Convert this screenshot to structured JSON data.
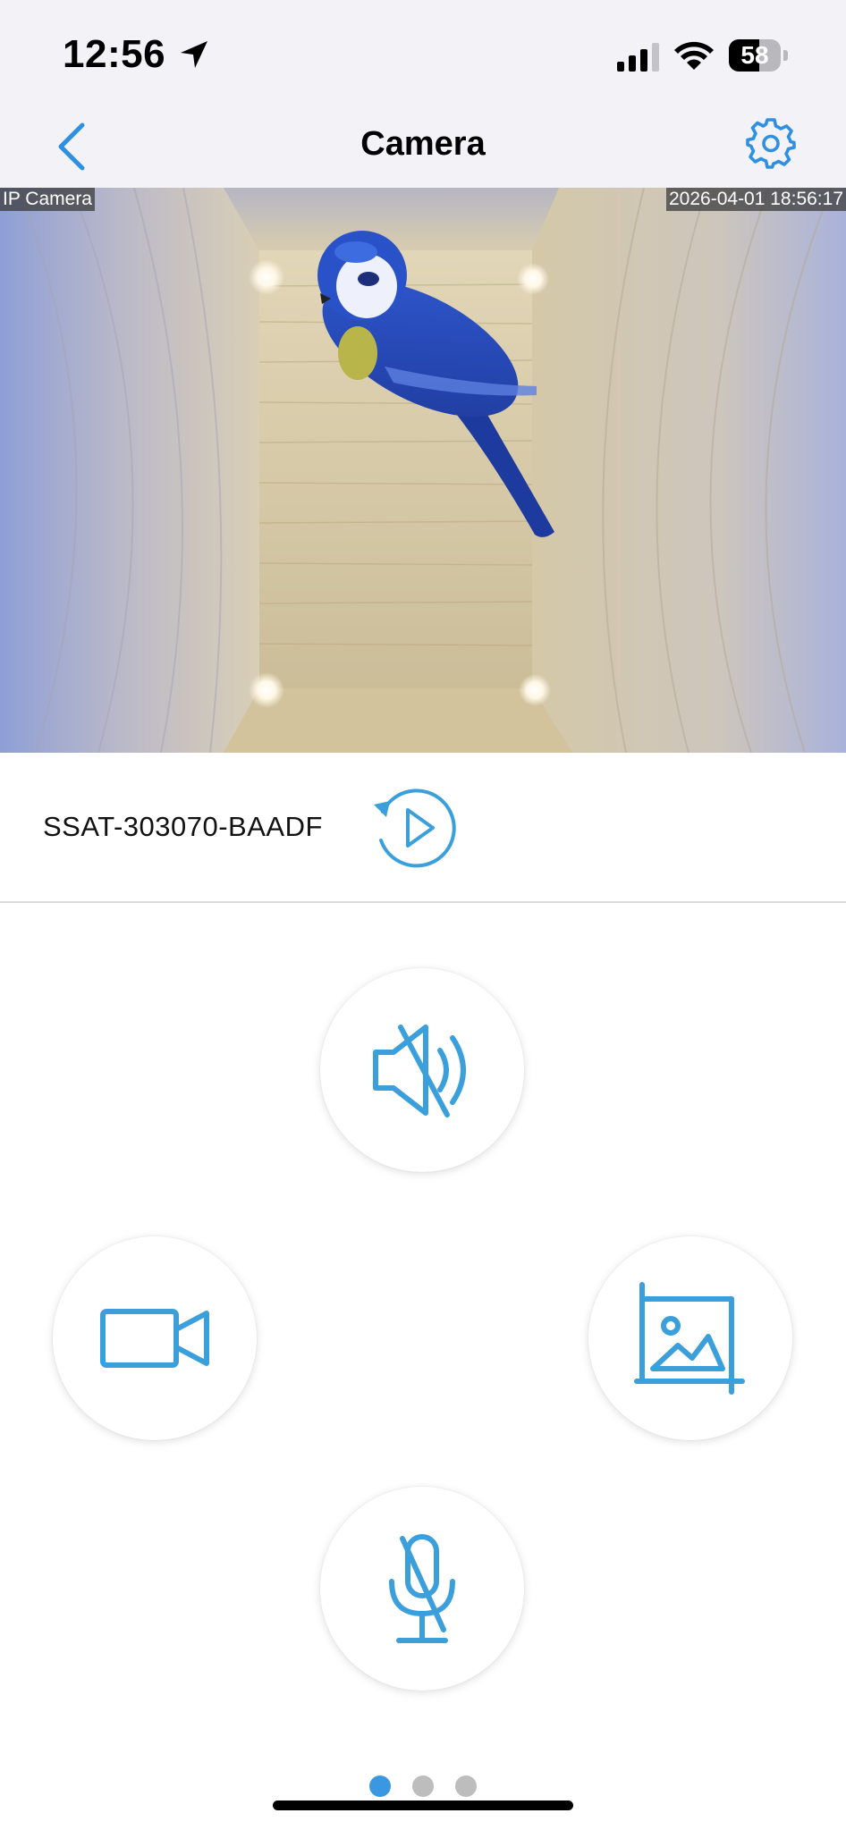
{
  "status_bar": {
    "time": "12:56",
    "battery_percent": "58",
    "battery_level": 0.58,
    "icons": [
      "location-arrow-icon",
      "cellular-signal-icon",
      "wifi-icon",
      "battery-icon"
    ]
  },
  "nav": {
    "title": "Camera",
    "back_icon": "chevron-left-icon",
    "settings_icon": "gear-icon"
  },
  "video": {
    "overlay_label": "IP Camera",
    "timestamp": "2026-04-01 18:56:17"
  },
  "device": {
    "name": "SSAT-303070-BAADF",
    "playback_icon": "replay-play-icon"
  },
  "controls": [
    {
      "id": "speaker",
      "icon": "speaker-muted-icon"
    },
    {
      "id": "record",
      "icon": "video-camera-icon"
    },
    {
      "id": "snapshot",
      "icon": "image-crop-icon"
    },
    {
      "id": "microphone",
      "icon": "microphone-muted-icon"
    }
  ],
  "pagination": {
    "pages": 3,
    "current": 1
  },
  "colors": {
    "accent": "#3a98e0",
    "icon_blue": "#3b9fdc",
    "nav_background": "#f2f2f7",
    "inactive_dot": "#bdbdbd"
  }
}
